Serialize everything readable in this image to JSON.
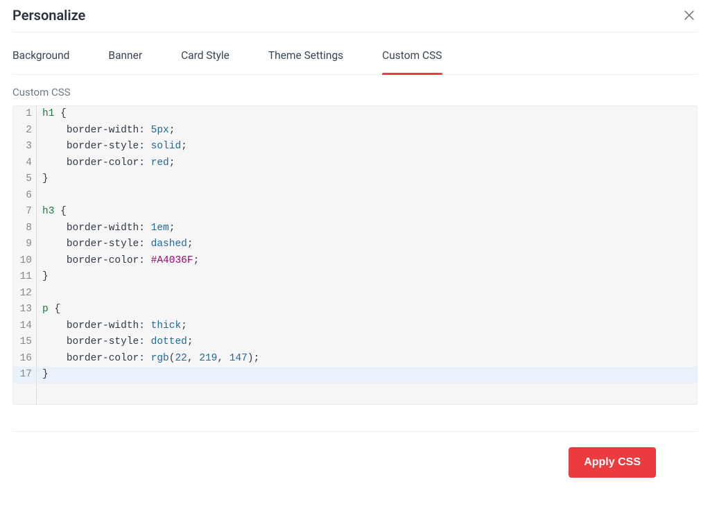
{
  "header": {
    "title": "Personalize"
  },
  "tabs": [
    {
      "label": "Background"
    },
    {
      "label": "Banner"
    },
    {
      "label": "Card Style"
    },
    {
      "label": "Theme Settings"
    },
    {
      "label": "Custom CSS",
      "active": true
    }
  ],
  "section": {
    "label": "Custom CSS"
  },
  "footer": {
    "apply_label": "Apply CSS"
  },
  "code": {
    "active_line": 17,
    "lines": [
      {
        "n": 1,
        "tokens": [
          {
            "t": "h1",
            "c": "tag"
          },
          {
            "t": " {",
            "c": "plain"
          }
        ]
      },
      {
        "n": 2,
        "tokens": [
          {
            "t": "    ",
            "c": "plain"
          },
          {
            "t": "border-width",
            "c": "prop"
          },
          {
            "t": ": ",
            "c": "plain"
          },
          {
            "t": "5px",
            "c": "num"
          },
          {
            "t": ";",
            "c": "plain"
          }
        ]
      },
      {
        "n": 3,
        "tokens": [
          {
            "t": "    ",
            "c": "plain"
          },
          {
            "t": "border-style",
            "c": "prop"
          },
          {
            "t": ": ",
            "c": "plain"
          },
          {
            "t": "solid",
            "c": "kw"
          },
          {
            "t": ";",
            "c": "plain"
          }
        ]
      },
      {
        "n": 4,
        "tokens": [
          {
            "t": "    ",
            "c": "plain"
          },
          {
            "t": "border-color",
            "c": "prop"
          },
          {
            "t": ": ",
            "c": "plain"
          },
          {
            "t": "red",
            "c": "kw"
          },
          {
            "t": ";",
            "c": "plain"
          }
        ]
      },
      {
        "n": 5,
        "tokens": [
          {
            "t": "}",
            "c": "plain"
          }
        ]
      },
      {
        "n": 6,
        "tokens": [
          {
            "t": "",
            "c": "plain"
          }
        ]
      },
      {
        "n": 7,
        "tokens": [
          {
            "t": "h3",
            "c": "tag"
          },
          {
            "t": " {",
            "c": "plain"
          }
        ]
      },
      {
        "n": 8,
        "tokens": [
          {
            "t": "    ",
            "c": "plain"
          },
          {
            "t": "border-width",
            "c": "prop"
          },
          {
            "t": ": ",
            "c": "plain"
          },
          {
            "t": "1em",
            "c": "num"
          },
          {
            "t": ";",
            "c": "plain"
          }
        ]
      },
      {
        "n": 9,
        "tokens": [
          {
            "t": "    ",
            "c": "plain"
          },
          {
            "t": "border-style",
            "c": "prop"
          },
          {
            "t": ": ",
            "c": "plain"
          },
          {
            "t": "dashed",
            "c": "kw"
          },
          {
            "t": ";",
            "c": "plain"
          }
        ]
      },
      {
        "n": 10,
        "tokens": [
          {
            "t": "    ",
            "c": "plain"
          },
          {
            "t": "border-color",
            "c": "prop"
          },
          {
            "t": ": ",
            "c": "plain"
          },
          {
            "t": "#A4036F",
            "c": "color"
          },
          {
            "t": ";",
            "c": "plain"
          }
        ]
      },
      {
        "n": 11,
        "tokens": [
          {
            "t": "}",
            "c": "plain"
          }
        ]
      },
      {
        "n": 12,
        "tokens": [
          {
            "t": "",
            "c": "plain"
          }
        ]
      },
      {
        "n": 13,
        "tokens": [
          {
            "t": "p",
            "c": "tag"
          },
          {
            "t": " {",
            "c": "plain"
          }
        ]
      },
      {
        "n": 14,
        "tokens": [
          {
            "t": "    ",
            "c": "plain"
          },
          {
            "t": "border-width",
            "c": "prop"
          },
          {
            "t": ": ",
            "c": "plain"
          },
          {
            "t": "thick",
            "c": "kw"
          },
          {
            "t": ";",
            "c": "plain"
          }
        ]
      },
      {
        "n": 15,
        "tokens": [
          {
            "t": "    ",
            "c": "plain"
          },
          {
            "t": "border-style",
            "c": "prop"
          },
          {
            "t": ": ",
            "c": "plain"
          },
          {
            "t": "dotted",
            "c": "kw"
          },
          {
            "t": ";",
            "c": "plain"
          }
        ]
      },
      {
        "n": 16,
        "tokens": [
          {
            "t": "    ",
            "c": "plain"
          },
          {
            "t": "border-color",
            "c": "prop"
          },
          {
            "t": ": ",
            "c": "plain"
          },
          {
            "t": "rgb",
            "c": "kw"
          },
          {
            "t": "(",
            "c": "plain"
          },
          {
            "t": "22",
            "c": "num"
          },
          {
            "t": ", ",
            "c": "plain"
          },
          {
            "t": "219",
            "c": "num"
          },
          {
            "t": ", ",
            "c": "plain"
          },
          {
            "t": "147",
            "c": "num"
          },
          {
            "t": ");",
            "c": "plain"
          }
        ]
      },
      {
        "n": 17,
        "tokens": [
          {
            "t": "}",
            "c": "plain"
          }
        ]
      }
    ]
  }
}
